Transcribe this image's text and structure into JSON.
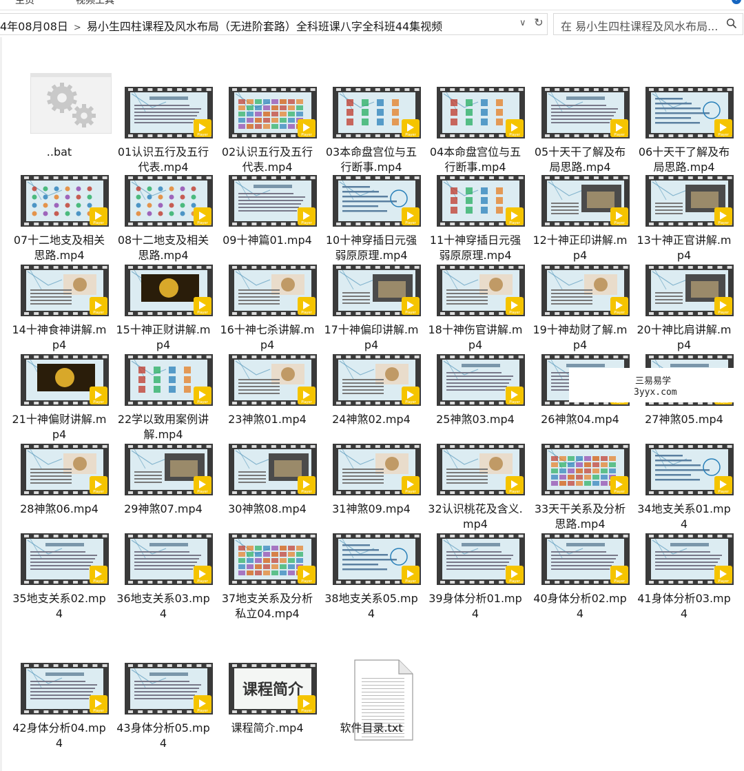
{
  "ribbon": {
    "tabs": [
      "主页",
      "视频工具"
    ]
  },
  "address_bar": {
    "path_segments": [
      "4年08月08日",
      "易小生四柱课程及风水布局（无进阶套路）全科班课八字全科班44集视频"
    ],
    "search_placeholder": "在 易小生四柱课程及风水布局...",
    "dropdown_glyph": "∨",
    "refresh_glyph": "↻"
  },
  "files": [
    {
      "name": "..bat",
      "type": "bat"
    },
    {
      "name": "01认识五行及五行代表.mp4",
      "type": "video",
      "variant": 0
    },
    {
      "name": "02认识五行及五行代表.mp4",
      "type": "video",
      "variant": 1
    },
    {
      "name": "03本命盘宫位与五行断事.mp4",
      "type": "video",
      "variant": 2
    },
    {
      "name": "04本命盘宫位与五行断事.mp4",
      "type": "video",
      "variant": 2
    },
    {
      "name": "05十天干了解及布局思路.mp4",
      "type": "video",
      "variant": 3
    },
    {
      "name": "06十天干了解及布局思路.mp4",
      "type": "video",
      "variant": 4
    },
    {
      "name": "07十二地支及相关思路.mp4",
      "type": "video",
      "variant": 5
    },
    {
      "name": "08十二地支及相关思路.mp4",
      "type": "video",
      "variant": 5
    },
    {
      "name": "09十神篇01.mp4",
      "type": "video",
      "variant": 3
    },
    {
      "name": "10十神穿插日元强弱原原理.mp4",
      "type": "video",
      "variant": 4
    },
    {
      "name": "11十神穿插日元强弱原原理.mp4",
      "type": "video",
      "variant": 2
    },
    {
      "name": "12十神正印讲解.mp4",
      "type": "video",
      "variant": 6
    },
    {
      "name": "13十神正官讲解.mp4",
      "type": "video",
      "variant": 6
    },
    {
      "name": "14十神食神讲解.mp4",
      "type": "video",
      "variant": 7
    },
    {
      "name": "15十神正财讲解.mp4",
      "type": "video",
      "variant": 8
    },
    {
      "name": "16十神七杀讲解.mp4",
      "type": "video",
      "variant": 7
    },
    {
      "name": "17十神偏印讲解.mp4",
      "type": "video",
      "variant": 6
    },
    {
      "name": "18十神伤官讲解.mp4",
      "type": "video",
      "variant": 7
    },
    {
      "name": "19十神劫财了解.mp4",
      "type": "video",
      "variant": 7
    },
    {
      "name": "20十神比肩讲解.mp4",
      "type": "video",
      "variant": 6
    },
    {
      "name": "21十神偏财讲解.mp4",
      "type": "video",
      "variant": 8
    },
    {
      "name": "22学以致用案例讲解.mp4",
      "type": "video",
      "variant": 2
    },
    {
      "name": "23神煞01.mp4",
      "type": "video",
      "variant": 7
    },
    {
      "name": "24神煞02.mp4",
      "type": "video",
      "variant": 7
    },
    {
      "name": "25神煞03.mp4",
      "type": "video",
      "variant": 3
    },
    {
      "name": "26神煞04.mp4",
      "type": "video",
      "variant": 3
    },
    {
      "name": "27神煞05.mp4",
      "type": "video",
      "variant": 3
    },
    {
      "name": "28神煞06.mp4",
      "type": "video",
      "variant": 7
    },
    {
      "name": "29神煞07.mp4",
      "type": "video",
      "variant": 6
    },
    {
      "name": "30神煞08.mp4",
      "type": "video",
      "variant": 6
    },
    {
      "name": "31神煞09.mp4",
      "type": "video",
      "variant": 7
    },
    {
      "name": "32认识桃花及含义.mp4",
      "type": "video",
      "variant": 7
    },
    {
      "name": "33天干关系及分析思路.mp4",
      "type": "video",
      "variant": 9
    },
    {
      "name": "34地支关系01.mp4",
      "type": "video",
      "variant": 4
    },
    {
      "name": "35地支关系02.mp4",
      "type": "video",
      "variant": 3
    },
    {
      "name": "36地支关系03.mp4",
      "type": "video",
      "variant": 3
    },
    {
      "name": "37地支关系及分析私立04.mp4",
      "type": "video",
      "variant": 1
    },
    {
      "name": "38地支关系05.mp4",
      "type": "video",
      "variant": 4
    },
    {
      "name": "39身体分析01.mp4",
      "type": "video",
      "variant": 3
    },
    {
      "name": "40身体分析02.mp4",
      "type": "video",
      "variant": 3
    },
    {
      "name": "41身体分析03.mp4",
      "type": "video",
      "variant": 3
    },
    {
      "name": "42身体分析04.mp4",
      "type": "video",
      "variant": 3
    },
    {
      "name": "43身体分析05.mp4",
      "type": "video",
      "variant": 3
    },
    {
      "name": "课程简介.mp4",
      "type": "video",
      "variant": 10,
      "thumb_text": "课程简介"
    },
    {
      "name": "软件目录.txt",
      "type": "txt"
    }
  ],
  "player_badge_text": "Player",
  "watermark": {
    "line1": "三易易学",
    "line2": "3yyx.com"
  },
  "colors": {
    "film": "#3a3a3a",
    "badge": "#f5c400",
    "slide_bg": "#dcecf2",
    "slide_accent": "#4a8fb5"
  }
}
